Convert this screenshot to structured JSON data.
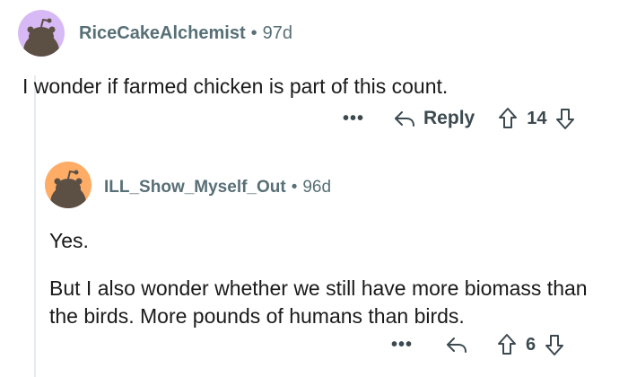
{
  "comment": {
    "username": "RiceCakeAlchemist",
    "separator": "•",
    "age": "97d",
    "body": "I wonder if farmed chicken is part of this count.",
    "actions": {
      "more": "•••",
      "reply_label": "Reply",
      "score": "14"
    }
  },
  "reply": {
    "username": "ILL_Show_Myself_Out",
    "separator": "•",
    "age": "96d",
    "paragraphs": [
      "Yes.",
      "But I also wonder whether we still have more biomass than the birds. More pounds of humans than birds."
    ],
    "actions": {
      "more": "•••",
      "score": "6"
    }
  },
  "colors": {
    "avatar1_bg": "#d7b9f5",
    "avatar2_bg": "#ffad66",
    "snoo_body": "#5c4f44",
    "meta_text": "#576f76",
    "thread_line": "#e5ebee"
  },
  "icons": [
    "avatar-snoo-icon",
    "reply-arrow-icon",
    "upvote-icon",
    "downvote-icon"
  ]
}
